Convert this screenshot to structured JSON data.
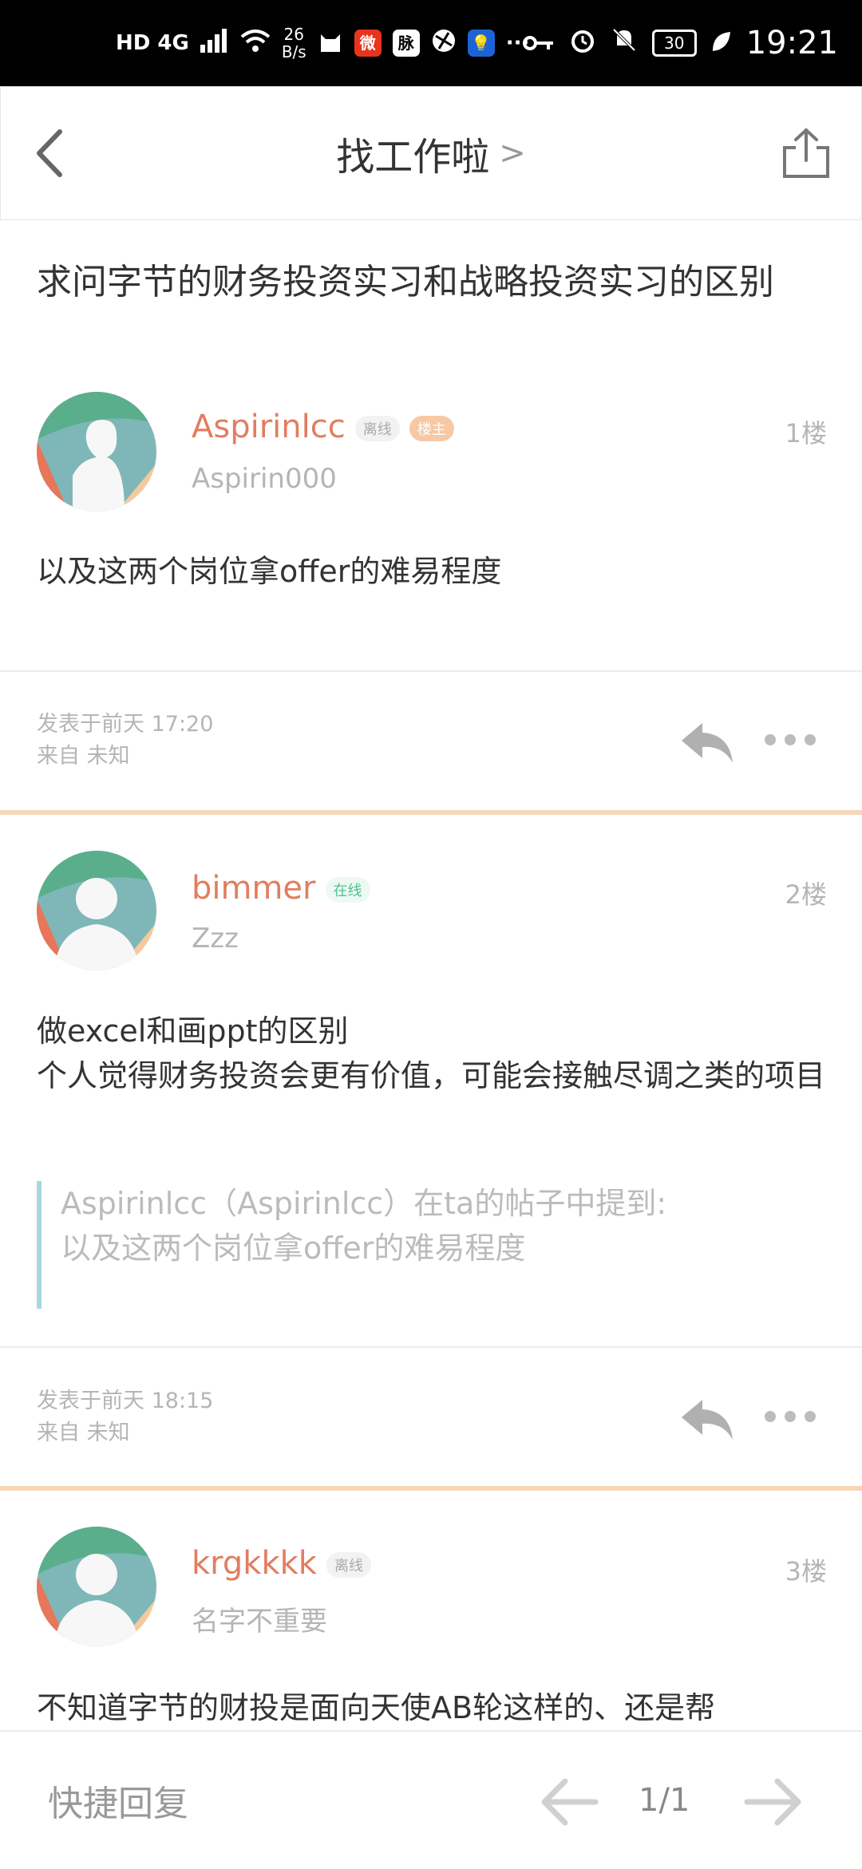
{
  "status_bar": {
    "network": "HD 4G",
    "net_speed_value": "26",
    "net_speed_unit": "B/s",
    "battery": "30",
    "time": "19:21",
    "more": "···"
  },
  "header": {
    "title": "找工作啦",
    "chevron": ">"
  },
  "thread": {
    "title": "求问字节的财务投资实习和战略投资实习的区别"
  },
  "posts": [
    {
      "username": "Aspirinlcc",
      "status_badge": "离线",
      "owner_badge": "楼主",
      "subname": "Aspirin000",
      "floor": "1楼",
      "content": "以及这两个岗位拿offer的难易程度",
      "posted": "发表于前天 17:20",
      "source": "来自 未知"
    },
    {
      "username": "bimmer",
      "status_badge": "在线",
      "subname": "Zzz",
      "floor": "2楼",
      "content_line1": "做excel和画ppt的区别",
      "content_line2": "个人觉得财务投资会更有价值，可能会接触尽调之类的项目",
      "quote_line1": "Aspirinlcc（Aspirinlcc）在ta的帖子中提到:",
      "quote_line2": "以及这两个岗位拿offer的难易程度",
      "posted": "发表于前天 18:15",
      "source": "来自 未知"
    },
    {
      "username": "krgkkkk",
      "status_badge": "离线",
      "subname": "名字不重要",
      "floor": "3楼",
      "content": "不知道字节的财投是面向天使AB轮这样的、还是帮"
    }
  ],
  "bottom_bar": {
    "quick_reply": "快捷回复",
    "page_indicator": "1/1"
  },
  "colors": {
    "username": "#e27d60",
    "separator": "#f7d6b8",
    "quote_border": "#a7d8de",
    "online": "#4ec08f",
    "owner_badge": "#f7c8a4"
  }
}
